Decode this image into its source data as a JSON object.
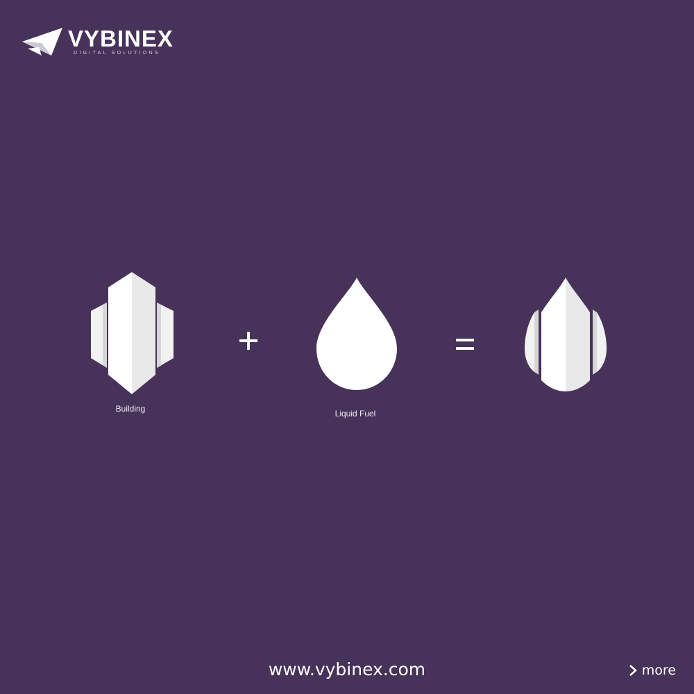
{
  "brand": {
    "name": "VYBINEX",
    "tagline": "DIGITAL SOLUTIONS",
    "logo_icon": "paper-plane-icon"
  },
  "equation": {
    "operand_1": {
      "icon": "building-icon",
      "caption": "Building"
    },
    "operator_1": "+",
    "operand_2": {
      "icon": "drop-icon",
      "caption": "Liquid Fuel"
    },
    "operator_2": "=",
    "result": {
      "icon": "building-drop-logo-icon"
    }
  },
  "footer": {
    "url": "www.vybinex.com",
    "more_label": "more"
  },
  "colors": {
    "background": "#473259",
    "foreground": "#ffffff",
    "shade": "#dadada"
  }
}
